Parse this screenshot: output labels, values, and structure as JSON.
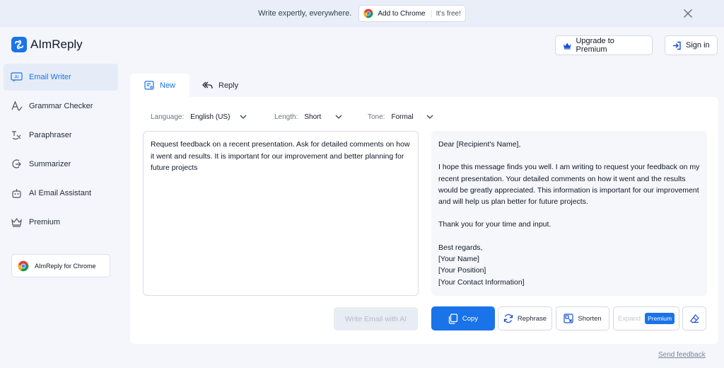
{
  "banner": {
    "text": "Write expertly, everywhere.",
    "chrome_label": "Add to Chrome",
    "free_label": "It's free!"
  },
  "header": {
    "brand": "AImReply",
    "upgrade_label": "Upgrade to Premium",
    "signin_label": "Sign in"
  },
  "sidebar": {
    "items": [
      {
        "label": "Email Writer",
        "icon": "ai-icon",
        "active": true
      },
      {
        "label": "Grammar Checker",
        "icon": "grammar-icon"
      },
      {
        "label": "Paraphraser",
        "icon": "paraphrase-icon"
      },
      {
        "label": "Summarizer",
        "icon": "summarize-icon"
      },
      {
        "label": "AI Email Assistant",
        "icon": "assistant-icon"
      },
      {
        "label": "Premium",
        "icon": "crown-icon"
      }
    ],
    "chrome_card_label": "AImReply for Chrome"
  },
  "tabs": {
    "new_label": "New",
    "reply_label": "Reply"
  },
  "options": {
    "language_label": "Language:",
    "language_value": "English (US)",
    "length_label": "Length:",
    "length_value": "Short",
    "tone_label": "Tone:",
    "tone_value": "Formal"
  },
  "input": {
    "text": "Request feedback on a recent presentation. Ask for detailed comments on how it went and results. It is important for our improvement and better planning for future projects"
  },
  "output": {
    "greeting": "Dear [Recipient's Name],",
    "body": "I hope this message finds you well. I am writing to request your feedback on my recent presentation. Your detailed comments on how it went and the results would be greatly appreciated. This information is important for our improvement and will help us plan better for future projects.",
    "thanks": "Thank you for your time and input.",
    "signoff": "Best regards,\n[Your Name]\n[Your Position]\n[Your Contact Information]"
  },
  "actions": {
    "write_label": "Write Email with AI",
    "copy_label": "Copy",
    "rephrase_label": "Rephrase",
    "shorten_label": "Shorten",
    "expand_label": "Expand",
    "premium_tag": "Premium"
  },
  "footer": {
    "feedback_label": "Send feedback"
  },
  "colors": {
    "accent": "#1a73e8",
    "banner_bg": "#e9eef9",
    "page_bg": "#f4f6fb"
  }
}
